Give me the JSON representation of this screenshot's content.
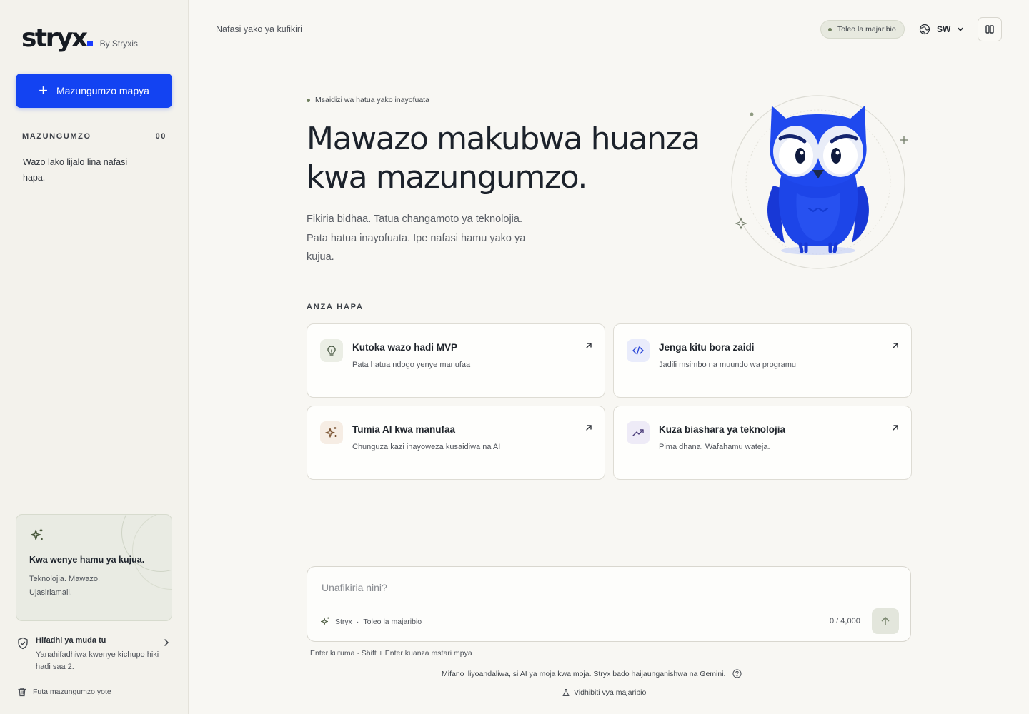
{
  "sidebar": {
    "logo": "stryx",
    "by_label": "By Stryxis",
    "new_chat_label": "Mazungumzo mapya",
    "conversations_heading": "MAZUNGUMZO",
    "conversations_count": "00",
    "empty_text": "Wazo lako lijalo lina nafasi hapa.",
    "promo_title": "Kwa wenye hamu ya kujua.",
    "promo_sub": "Teknolojia. Mawazo. Ujasiriamali.",
    "storage_title": "Hifadhi ya muda tu",
    "storage_sub": "Yanahifadhiwa kwenye kichupo hiki hadi saa 2.",
    "delete_all_label": "Futa mazungumzo yote"
  },
  "header": {
    "breadcrumb": "Nafasi yako ya kufikiri",
    "beta_badge": "Toleo la majaribio",
    "language": "SW"
  },
  "hero": {
    "eyebrow": "Msaidizi wa hatua yako inayofuata",
    "title": "Mawazo makubwa huanza kwa mazungumzo.",
    "subtitle": "Fikiria bidhaa. Tatua changamoto ya teknolojia. Pata hatua inayofuata. Ipe nafasi hamu yako ya kujua."
  },
  "start": {
    "heading": "ANZA HAPA",
    "cards": [
      {
        "title": "Kutoka wazo hadi MVP",
        "subtitle": "Pata hatua ndogo yenye manufaa",
        "icon": "lightbulb-icon"
      },
      {
        "title": "Jenga kitu bora zaidi",
        "subtitle": "Jadili msimbo na muundo wa programu",
        "icon": "code-icon"
      },
      {
        "title": "Tumia AI kwa manufaa",
        "subtitle": "Chunguza kazi inayoweza kusaidiwa na AI",
        "icon": "sparkles-icon"
      },
      {
        "title": "Kuza biashara ya teknolojia",
        "subtitle": "Pima dhana. Wafahamu wateja.",
        "icon": "trending-up-icon"
      }
    ]
  },
  "composer": {
    "placeholder": "Unafikiria nini?",
    "model_label": "Stryx",
    "mode_label": "Toleo la majaribio",
    "char_count": "0 / 4,000",
    "keyboard_hint": "Enter kutuma · Shift + Enter kuanza mstari mpya",
    "disclaimer": "Mifano iliyoandaliwa, si AI ya moja kwa moja. Stryx bado haijaunganishwa na Gemini.",
    "controls_link": "Vidhibiti vya majaribio"
  },
  "colors": {
    "accent": "#1343f2",
    "background": "#f8f7f3",
    "sidebar": "#f3f2ec",
    "owl_blue": "#1d45e8"
  }
}
